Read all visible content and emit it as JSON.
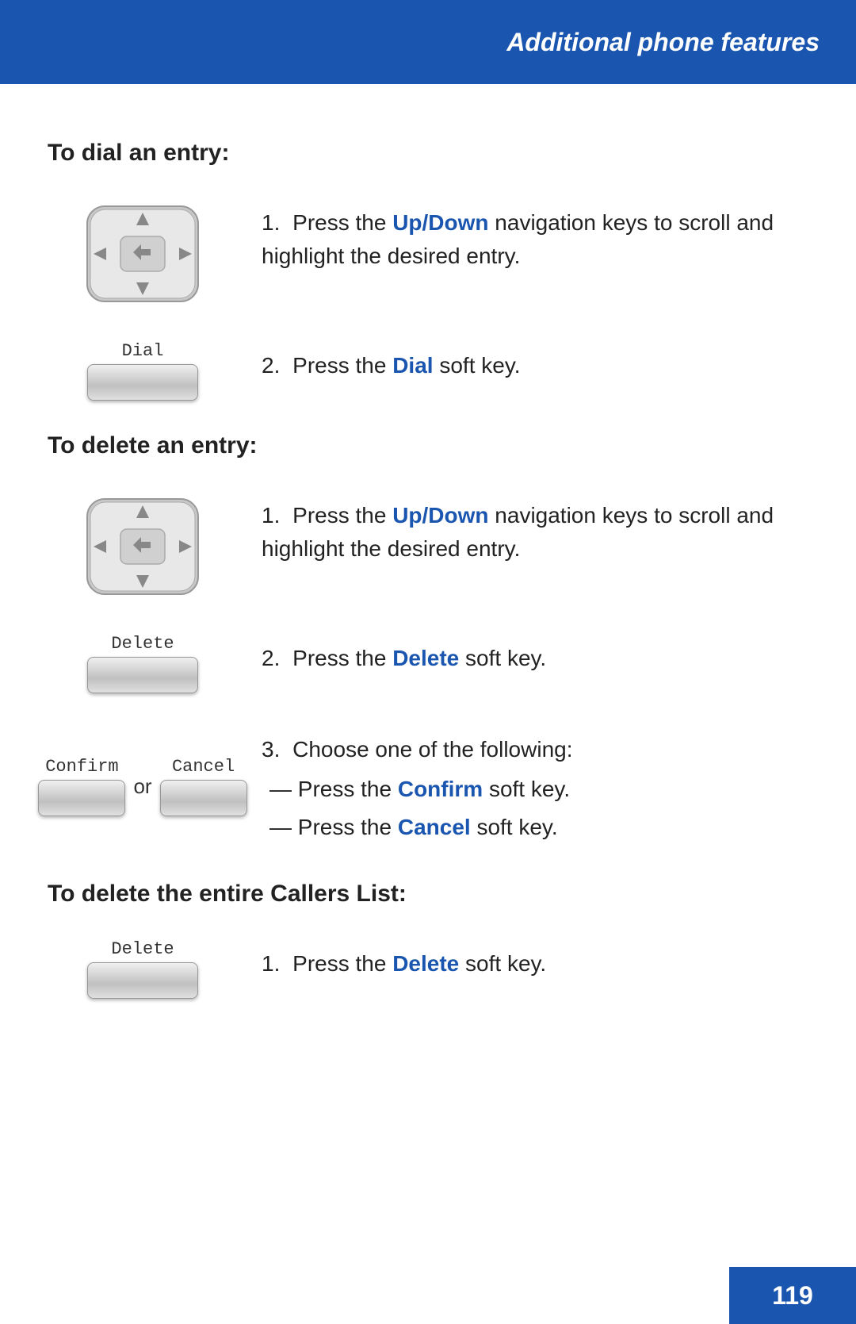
{
  "header": {
    "title": "Additional phone features",
    "background_color": "#1a56b0"
  },
  "page_number": "119",
  "sections": [
    {
      "id": "dial-entry",
      "heading": "To dial an entry:",
      "steps": [
        {
          "number": "1.",
          "image_type": "nav-key",
          "text_parts": [
            {
              "text": "Press the ",
              "style": "normal"
            },
            {
              "text": "Up/Down",
              "style": "bold-blue"
            },
            {
              "text": " navigation keys to scroll and highlight the desired entry.",
              "style": "normal"
            }
          ]
        },
        {
          "number": "2.",
          "image_type": "soft-key",
          "label": "Dial",
          "text_parts": [
            {
              "text": "Press the ",
              "style": "normal"
            },
            {
              "text": "Dial",
              "style": "bold-blue"
            },
            {
              "text": " soft key.",
              "style": "normal"
            }
          ]
        }
      ]
    },
    {
      "id": "delete-entry",
      "heading": "To delete an entry:",
      "steps": [
        {
          "number": "1.",
          "image_type": "nav-key",
          "text_parts": [
            {
              "text": "Press the ",
              "style": "normal"
            },
            {
              "text": "Up/Down",
              "style": "bold-blue"
            },
            {
              "text": " navigation keys to scroll and highlight the desired entry.",
              "style": "normal"
            }
          ]
        },
        {
          "number": "2.",
          "image_type": "soft-key",
          "label": "Delete",
          "text_parts": [
            {
              "text": "Press the ",
              "style": "normal"
            },
            {
              "text": "Delete",
              "style": "bold-blue"
            },
            {
              "text": " soft key.",
              "style": "normal"
            }
          ]
        },
        {
          "number": "3.",
          "image_type": "confirm-cancel",
          "confirm_label": "Confirm",
          "cancel_label": "Cancel",
          "intro": "Choose one of the following:",
          "sub_items": [
            {
              "text_parts": [
                {
                  "text": "Press the ",
                  "style": "normal"
                },
                {
                  "text": "Confirm",
                  "style": "bold-blue"
                },
                {
                  "text": " soft key.",
                  "style": "normal"
                }
              ]
            },
            {
              "text_parts": [
                {
                  "text": "Press the ",
                  "style": "normal"
                },
                {
                  "text": "Cancel",
                  "style": "bold-blue"
                },
                {
                  "text": " soft key.",
                  "style": "normal"
                }
              ]
            }
          ]
        }
      ]
    },
    {
      "id": "delete-callers-list",
      "heading": "To delete the entire Callers List:",
      "steps": [
        {
          "number": "1.",
          "image_type": "soft-key",
          "label": "Delete",
          "text_parts": [
            {
              "text": "Press the ",
              "style": "normal"
            },
            {
              "text": "Delete",
              "style": "bold-blue"
            },
            {
              "text": " soft key.",
              "style": "normal"
            }
          ]
        }
      ]
    }
  ]
}
